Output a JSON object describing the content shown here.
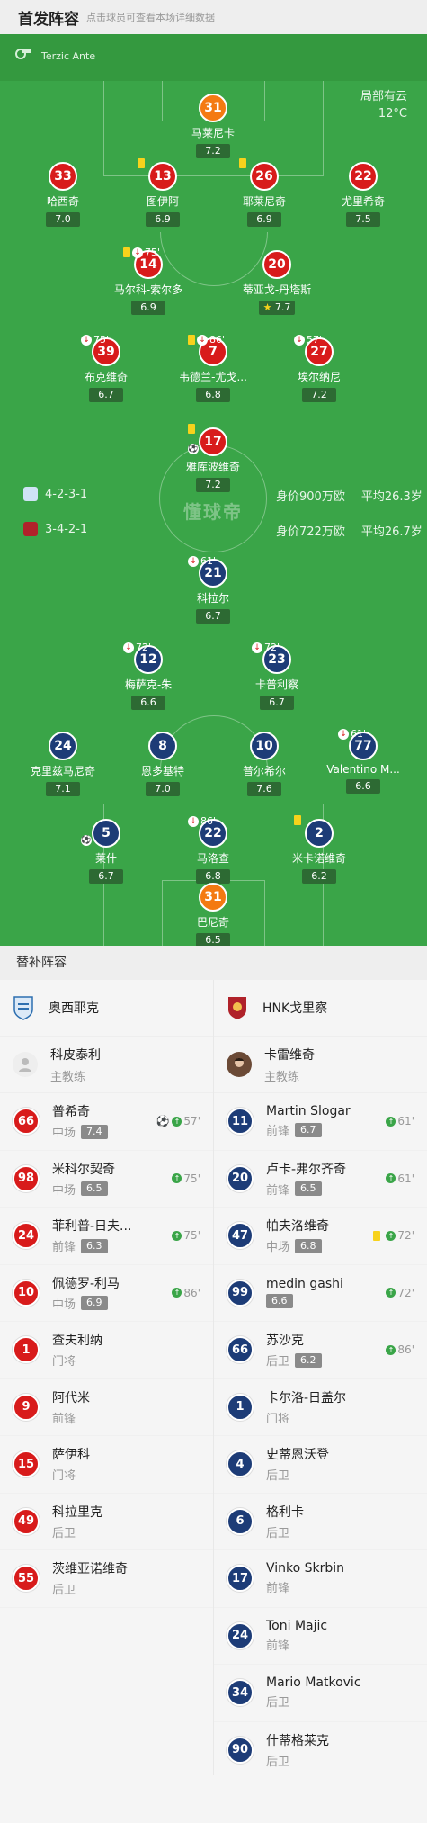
{
  "header": {
    "title": "首发阵容",
    "subtitle": "点击球员可查看本场详细数据"
  },
  "referee": "Terzic Ante",
  "weather": {
    "desc": "局部有云",
    "temp": "12°C"
  },
  "watermark": "懂球帝",
  "home": {
    "formation": "4-2-3-1",
    "value": "身价900万欧",
    "age": "平均26.3岁",
    "players": [
      {
        "num": "31",
        "name": "马莱尼卡",
        "rating": "7.2",
        "gk": true
      },
      {
        "num": "33",
        "name": "哈西奇",
        "rating": "7.0"
      },
      {
        "num": "13",
        "name": "图伊阿",
        "rating": "6.9",
        "yellow": true
      },
      {
        "num": "26",
        "name": "耶莱尼奇",
        "rating": "6.9",
        "yellow": true
      },
      {
        "num": "22",
        "name": "尤里希奇",
        "rating": "7.5"
      },
      {
        "num": "14",
        "name": "马尔科-索尔多",
        "rating": "6.9",
        "yellow": true,
        "sub": "75'"
      },
      {
        "num": "20",
        "name": "蒂亚戈-丹塔斯",
        "rating": "7.7",
        "star": true
      },
      {
        "num": "39",
        "name": "布克维奇",
        "rating": "6.7",
        "sub": "75'"
      },
      {
        "num": "7",
        "name": "韦德兰-尤戈...",
        "rating": "6.8",
        "yellow": true,
        "sub": "86'"
      },
      {
        "num": "27",
        "name": "埃尔纳尼",
        "rating": "7.2",
        "sub": "57'"
      },
      {
        "num": "17",
        "name": "雅库波维奇",
        "rating": "7.2",
        "yellow": true,
        "goal": true
      }
    ]
  },
  "away": {
    "formation": "3-4-2-1",
    "value": "身价722万欧",
    "age": "平均26.7岁",
    "players": [
      {
        "num": "21",
        "name": "科拉尔",
        "rating": "6.7",
        "sub": "61'"
      },
      {
        "num": "12",
        "name": "梅萨克-朱",
        "rating": "6.6",
        "sub": "72'"
      },
      {
        "num": "23",
        "name": "卡普利察",
        "rating": "6.7",
        "sub": "72'"
      },
      {
        "num": "24",
        "name": "克里兹马尼奇",
        "rating": "7.1"
      },
      {
        "num": "8",
        "name": "恩多基特",
        "rating": "7.0"
      },
      {
        "num": "10",
        "name": "普尔希尔",
        "rating": "7.6"
      },
      {
        "num": "77",
        "name": "Valentino M...",
        "rating": "6.6",
        "sub": "61'"
      },
      {
        "num": "5",
        "name": "莱什",
        "rating": "6.7",
        "goal": true
      },
      {
        "num": "22",
        "name": "马洛查",
        "rating": "6.8",
        "sub": "86'"
      },
      {
        "num": "2",
        "name": "米卡诺维奇",
        "rating": "6.2",
        "yellow": true
      },
      {
        "num": "31",
        "name": "巴尼奇",
        "rating": "6.5",
        "gk": true
      }
    ]
  },
  "subs_title": "替补阵容",
  "subs": {
    "left": {
      "team": "奥西耶克",
      "coach": {
        "name": "科皮泰利",
        "role": "主教练"
      },
      "players": [
        {
          "num": "66",
          "name": "普希奇",
          "pos": "中场",
          "rating": "7.4",
          "event": "57'",
          "goal": true
        },
        {
          "num": "98",
          "name": "米科尔契奇",
          "pos": "中场",
          "rating": "6.5",
          "event": "75'"
        },
        {
          "num": "24",
          "name": "菲利普-日夫...",
          "pos": "前锋",
          "rating": "6.3",
          "event": "75'"
        },
        {
          "num": "10",
          "name": "佩德罗-利马",
          "pos": "中场",
          "rating": "6.9",
          "event": "86'"
        },
        {
          "num": "1",
          "name": "查夫利纳",
          "pos": "门将"
        },
        {
          "num": "9",
          "name": "阿代米",
          "pos": "前锋"
        },
        {
          "num": "15",
          "name": "萨伊科",
          "pos": "门将"
        },
        {
          "num": "49",
          "name": "科拉里克",
          "pos": "后卫"
        },
        {
          "num": "55",
          "name": "茨维亚诺维奇",
          "pos": "后卫"
        }
      ]
    },
    "right": {
      "team": "HNK戈里察",
      "coach": {
        "name": "卡雷维奇",
        "role": "主教练"
      },
      "players": [
        {
          "num": "11",
          "name": "Martin Slogar",
          "pos": "前锋",
          "rating": "6.7",
          "event": "61'"
        },
        {
          "num": "20",
          "name": "卢卡-弗尔齐奇",
          "pos": "前锋",
          "rating": "6.5",
          "event": "61'"
        },
        {
          "num": "47",
          "name": "帕夫洛维奇",
          "pos": "中场",
          "rating": "6.8",
          "event": "72'",
          "yellow": true
        },
        {
          "num": "99",
          "name": "medin gashi",
          "pos": "",
          "rating": "6.6",
          "event": "72'"
        },
        {
          "num": "66",
          "name": "苏沙克",
          "pos": "后卫",
          "rating": "6.2",
          "event": "86'"
        },
        {
          "num": "1",
          "name": "卡尔洛-日盖尔",
          "pos": "门将"
        },
        {
          "num": "4",
          "name": "史蒂恩沃登",
          "pos": "后卫"
        },
        {
          "num": "6",
          "name": "格利卡",
          "pos": "后卫"
        },
        {
          "num": "17",
          "name": "Vinko Skrbin",
          "pos": "前锋"
        },
        {
          "num": "24",
          "name": "Toni Majic",
          "pos": "前锋"
        },
        {
          "num": "34",
          "name": "Mario Matkovic",
          "pos": "后卫"
        },
        {
          "num": "90",
          "name": "什蒂格莱克",
          "pos": "后卫"
        }
      ]
    }
  }
}
